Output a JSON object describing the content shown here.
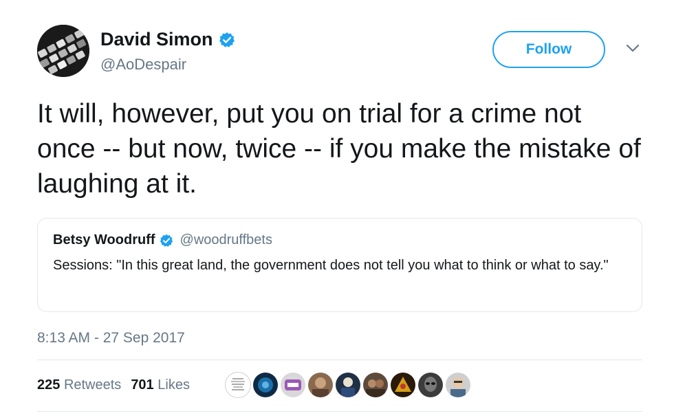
{
  "author": {
    "display_name": "David Simon",
    "handle": "@AoDespair"
  },
  "follow_button": {
    "label": "Follow"
  },
  "tweet": {
    "text": "It will, however, put you on trial for a crime not once -- but now, twice -- if you make the mistake of laughing at it.",
    "timestamp": "8:13 AM - 27 Sep 2017"
  },
  "quoted_tweet": {
    "display_name": "Betsy Woodruff",
    "handle": "@woodruffbets",
    "text": "Sessions: \"In this great land, the government does not tell you what to think or what to say.\""
  },
  "stats": {
    "retweets_count": "225",
    "retweets_label": "Retweets",
    "likes_count": "701",
    "likes_label": "Likes"
  },
  "colors": {
    "accent": "#1da1f2",
    "secondary_text": "#657786",
    "border": "#e1e8ed"
  },
  "icons": {
    "verified": "verified-badge-icon",
    "more": "chevron-down-icon"
  }
}
